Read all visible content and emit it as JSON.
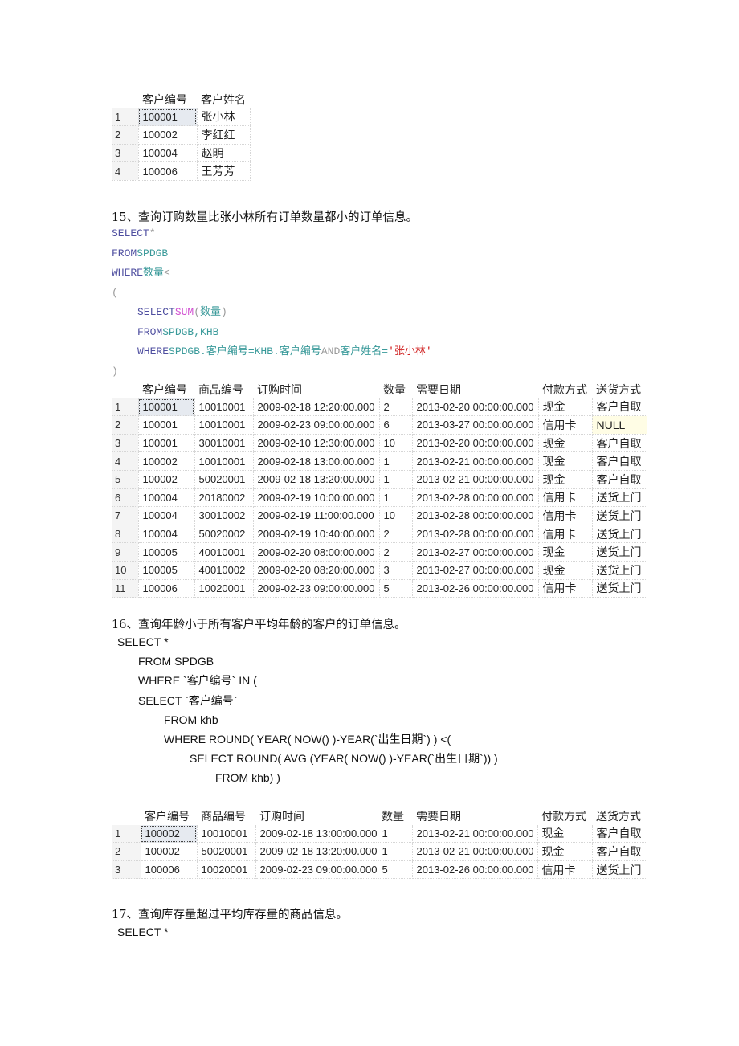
{
  "table1": {
    "headers": [
      "客户编号",
      "客户姓名"
    ],
    "rows": [
      [
        "1",
        "100001",
        "张小林"
      ],
      [
        "2",
        "100002",
        "李红红"
      ],
      [
        "3",
        "100004",
        "赵明"
      ],
      [
        "4",
        "100006",
        "王芳芳"
      ]
    ]
  },
  "q15": {
    "title": "15、查询订购数量比张小林所有订单数量都小的订单信息。",
    "line1": {
      "kw": "SELECT",
      "rest": "*"
    },
    "line2": {
      "kw": "FROM",
      "id": "SPDGB"
    },
    "line3": {
      "kw": "WHERE",
      "id": "数量",
      "op": "<"
    },
    "line4": "(",
    "line5": {
      "kw": "SELECT",
      "fn": "SUM",
      "open": "(",
      "id": "数量",
      "close": ")"
    },
    "line6": {
      "kw": "FROM",
      "id": "SPDGB,KHB"
    },
    "line7": {
      "kw": "WHERE",
      "id1": "SPDGB.客户编号=KHB.客户编号",
      "and": "AND",
      "id2": "客户姓名=",
      "str": "'张小林'"
    },
    "line8": ")"
  },
  "table2": {
    "headers": [
      "客户编号",
      "商品编号",
      "订购时间",
      "数量",
      "需要日期",
      "付款方式",
      "送货方式"
    ],
    "rows": [
      [
        "1",
        "100001",
        "10010001",
        "2009-02-18 12:20:00.000",
        "2",
        "2013-02-20 00:00:00.000",
        "现金",
        "客户自取"
      ],
      [
        "2",
        "100001",
        "10010001",
        "2009-02-23 09:00:00.000",
        "6",
        "2013-03-27 00:00:00.000",
        "信用卡",
        "NULL"
      ],
      [
        "3",
        "100001",
        "30010001",
        "2009-02-10 12:30:00.000",
        "10",
        "2013-02-20 00:00:00.000",
        "现金",
        "客户自取"
      ],
      [
        "4",
        "100002",
        "10010001",
        "2009-02-18 13:00:00.000",
        "1",
        "2013-02-21 00:00:00.000",
        "现金",
        "客户自取"
      ],
      [
        "5",
        "100002",
        "50020001",
        "2009-02-18 13:20:00.000",
        "1",
        "2013-02-21 00:00:00.000",
        "现金",
        "客户自取"
      ],
      [
        "6",
        "100004",
        "20180002",
        "2009-02-19 10:00:00.000",
        "1",
        "2013-02-28 00:00:00.000",
        "信用卡",
        "送货上门"
      ],
      [
        "7",
        "100004",
        "30010002",
        "2009-02-19 11:00:00.000",
        "10",
        "2013-02-28 00:00:00.000",
        "信用卡",
        "送货上门"
      ],
      [
        "8",
        "100004",
        "50020002",
        "2009-02-19 10:40:00.000",
        "2",
        "2013-02-28 00:00:00.000",
        "信用卡",
        "送货上门"
      ],
      [
        "9",
        "100005",
        "40010001",
        "2009-02-20 08:00:00.000",
        "2",
        "2013-02-27 00:00:00.000",
        "现金",
        "送货上门"
      ],
      [
        "10",
        "100005",
        "40010002",
        "2009-02-20 08:20:00.000",
        "3",
        "2013-02-27 00:00:00.000",
        "现金",
        "送货上门"
      ],
      [
        "11",
        "100006",
        "10020001",
        "2009-02-23 09:00:00.000",
        "5",
        "2013-02-26 00:00:00.000",
        "信用卡",
        "送货上门"
      ]
    ]
  },
  "q16": {
    "title": "16、查询年龄小于所有客户平均年龄的客户的订单信息。",
    "lines": [
      "SELECT *",
      "FROM SPDGB",
      "WHERE `客户编号` IN (",
      "SELECT `客户编号`",
      "FROM khb",
      "WHERE ROUND( YEAR( NOW() )-YEAR(`出生日期`) ) <(",
      "SELECT ROUND( AVG (YEAR( NOW() )-YEAR(`出生日期`)) )",
      "FROM khb) )"
    ]
  },
  "table3": {
    "headers": [
      "客户编号",
      "商品编号",
      "订购时间",
      "数量",
      "需要日期",
      "付款方式",
      "送货方式"
    ],
    "rows": [
      [
        "1",
        "100002",
        "10010001",
        "2009-02-18 13:00:00.000",
        "1",
        "2013-02-21 00:00:00.000",
        "现金",
        "客户自取"
      ],
      [
        "2",
        "100002",
        "50020001",
        "2009-02-18 13:20:00.000",
        "1",
        "2013-02-21 00:00:00.000",
        "现金",
        "客户自取"
      ],
      [
        "3",
        "100006",
        "10020001",
        "2009-02-23 09:00:00.000",
        "5",
        "2013-02-26 00:00:00.000",
        "信用卡",
        "送货上门"
      ]
    ]
  },
  "q17": {
    "title": "17、查询库存量超过平均库存量的商品信息。",
    "lines": [
      "SELECT *"
    ]
  }
}
